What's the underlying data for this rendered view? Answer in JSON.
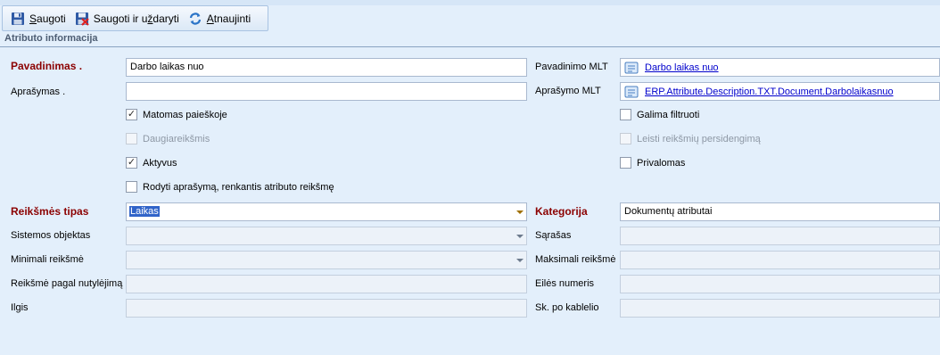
{
  "toolbar": {
    "save_label_first": "S",
    "save_label_rest": "augoti",
    "save_close_label": "Saugoti ir u",
    "save_close_u": "ž",
    "save_close_rest": "daryti",
    "refresh_label_first": "A",
    "refresh_label_rest": "tnaujinti"
  },
  "section": {
    "title": "Atributo informacija"
  },
  "fields": {
    "name_label": "Pavadinimas .",
    "name_value": "Darbo laikas nuo",
    "description_label": "Aprašymas .",
    "description_value": "",
    "name_mlt_label": "Pavadinimo MLT",
    "name_mlt_value": "Darbo laikas nuo",
    "description_mlt_label": "Aprašymo MLT",
    "description_mlt_value": "ERP.Attribute.Description.TXT.Document.Darbolaikasnuo",
    "value_type_label": "Reikšmės tipas",
    "value_type_value": "Laikas",
    "category_label": "Kategorija",
    "category_value": "Dokumentų atributai",
    "system_objects_label": "Sistemos objektas",
    "list_label": "Sąrašas",
    "min_value_label": "Minimali reikšmė",
    "max_value_label": "Maksimali reikšmė",
    "default_value_label": "Reikšmė pagal nutylėjimą",
    "order_number_label": "Eilės numeris",
    "length_label": "Ilgis",
    "decimals_label": "Sk. po kablelio"
  },
  "checkboxes": {
    "searchable": {
      "label": "Matomas paieškoje",
      "checked": true
    },
    "multi_value": {
      "label": "Daugiareikšmis",
      "checked": false
    },
    "active": {
      "label": "Aktyvus",
      "checked": true
    },
    "show_description": {
      "label": "Rodyti aprašymą, renkantis atributo reikšmę",
      "checked": false
    },
    "filterable": {
      "label": "Galima filtruoti",
      "checked": false
    },
    "allow_overlap": {
      "label": "Leisti reikšmių persidengimą",
      "checked": false
    },
    "required": {
      "label": "Privalomas",
      "checked": false
    }
  },
  "check_glyph": "✓"
}
